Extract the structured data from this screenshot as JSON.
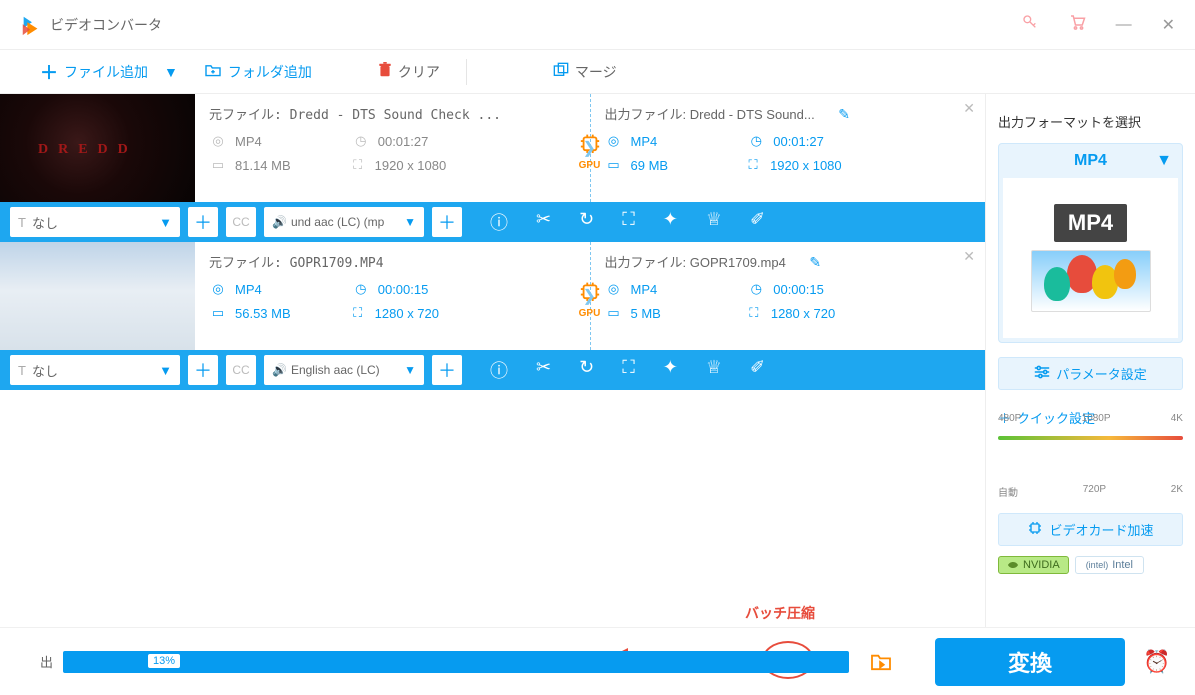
{
  "title": "ビデオコンバータ",
  "toolbar": {
    "add_file": "ファイル追加",
    "add_folder": "フォルダ追加",
    "clear": "クリア",
    "merge": "マージ"
  },
  "items": [
    {
      "source": {
        "label": "元ファイル: Dredd - DTS Sound Check ...",
        "format": "MP4",
        "duration": "00:01:27",
        "size": "81.14 MB",
        "resolution": "1920 x 1080"
      },
      "output": {
        "label": "出力ファイル: Dredd - DTS Sound...",
        "format": "MP4",
        "duration": "00:01:27",
        "size": "69 MB",
        "resolution": "1920 x 1080"
      },
      "subtitle_option": "なし",
      "audio_option": "und aac (LC) (mp",
      "gpu_badge": "GPU"
    },
    {
      "source": {
        "label": "元ファイル: GOPR1709.MP4",
        "format": "MP4",
        "duration": "00:00:15",
        "size": "56.53 MB",
        "resolution": "1280 x 720"
      },
      "output": {
        "label": "出力ファイル: GOPR1709.mp4",
        "format": "MP4",
        "duration": "00:00:15",
        "size": "5 MB",
        "resolution": "1280 x 720"
      },
      "subtitle_option": "なし",
      "audio_option": "English aac (LC)",
      "gpu_badge": "GPU"
    }
  ],
  "sidebar": {
    "title": "出力フォーマットを選択",
    "format_label": "MP4",
    "format_badge": "MP4",
    "param_button": "パラメータ設定",
    "quick_title": "クイック設定",
    "quality_top": [
      "480P",
      "1080P",
      "4K"
    ],
    "quality_bottom": [
      "自動",
      "720P",
      "2K"
    ],
    "gpu_button": "ビデオカード加速",
    "nvidia": "NVIDIA",
    "intel": "Intel"
  },
  "footer": {
    "output_label": "出",
    "progress_percent": "13%",
    "batch_label": "バッチ圧縮",
    "convert": "変換"
  }
}
